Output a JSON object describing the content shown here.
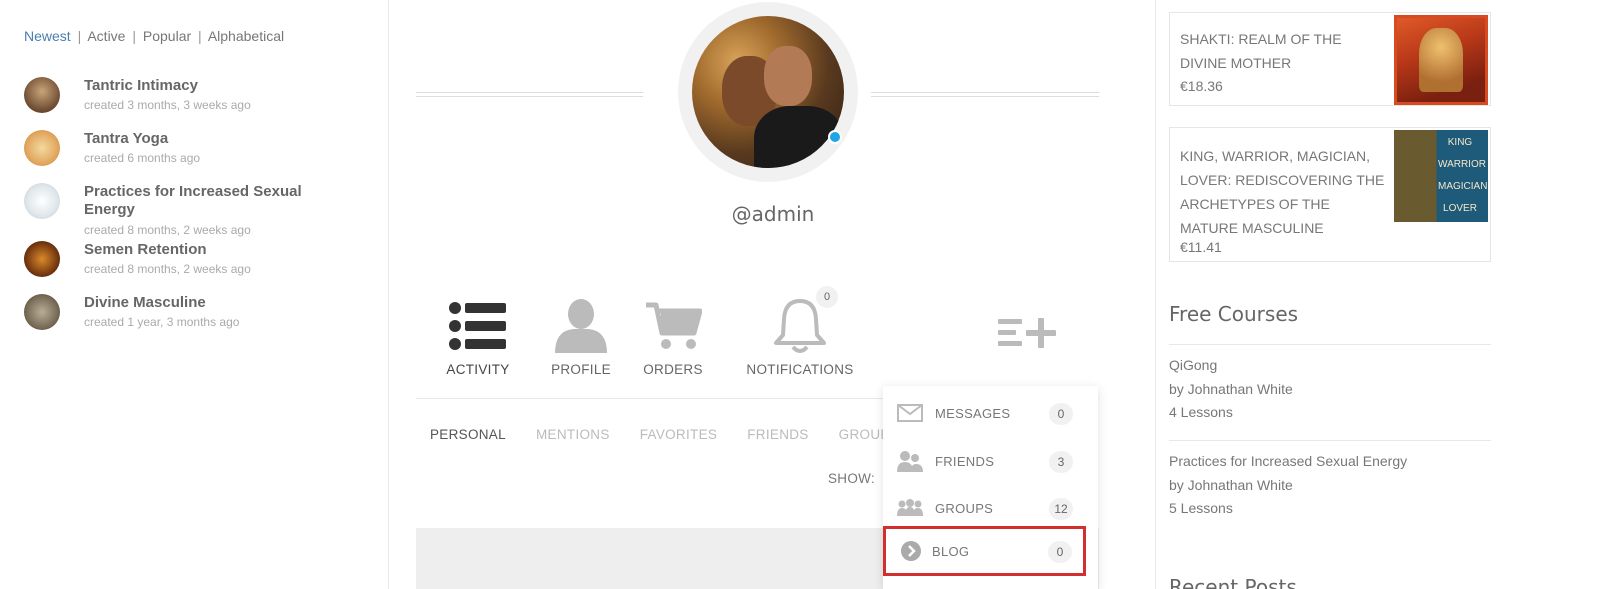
{
  "groups_filter": {
    "newest": "Newest",
    "active": "Active",
    "popular": "Popular",
    "alphabetical": "Alphabetical",
    "separator": "|"
  },
  "groups": [
    {
      "name": "Tantric Intimacy",
      "meta": "created 3 months, 3 weeks ago"
    },
    {
      "name": "Tantra Yoga",
      "meta": "created 6 months ago"
    },
    {
      "name": "Practices for Increased Sexual Energy",
      "meta": "created 8 months, 2 weeks ago"
    },
    {
      "name": "Semen Retention",
      "meta": "created 8 months, 2 weeks ago"
    },
    {
      "name": "Divine Masculine",
      "meta": "created 1 year, 3 months ago"
    }
  ],
  "profile": {
    "username": "@admin",
    "online_color": "#20a4e8"
  },
  "main_nav": [
    {
      "label": "ACTIVITY",
      "icon": "activity-list-icon"
    },
    {
      "label": "PROFILE",
      "icon": "user-silhouette-icon"
    },
    {
      "label": "ORDERS",
      "icon": "shopping-cart-icon"
    },
    {
      "label": "NOTIFICATIONS",
      "icon": "bell-icon",
      "count": "0"
    }
  ],
  "sub_nav": [
    "PERSONAL",
    "MENTIONS",
    "FAVORITES",
    "FRIENDS",
    "GROUPS"
  ],
  "show_label": "SHOW:",
  "dropdown": [
    {
      "label": "MESSAGES",
      "count": "0",
      "icon": "envelope-icon"
    },
    {
      "label": "FRIENDS",
      "count": "3",
      "icon": "friends-icon"
    },
    {
      "label": "GROUPS",
      "count": "12",
      "icon": "groups-icon"
    },
    {
      "label": "BLOG",
      "count": "0",
      "icon": "arrow-circle-icon"
    }
  ],
  "highlight_color": "#d32f2f",
  "products": [
    {
      "title": "SHAKTI: REALM OF THE DIVINE MOTHER",
      "price": "€18.36"
    },
    {
      "title": "KING, WARRIOR, MAGICIAN, LOVER: REDISCOVERING THE ARCHETYPES OF THE MATURE MASCULINE",
      "price": "€11.41",
      "cover_text": [
        "KING",
        "WARRIOR",
        "MAGICIAN",
        "LOVER"
      ]
    }
  ],
  "free_courses": {
    "title": "Free Courses",
    "items": [
      {
        "name": "QiGong",
        "author": "by Johnathan White",
        "lessons": "4 Lessons"
      },
      {
        "name": "Practices for Increased Sexual Energy",
        "author": "by Johnathan White",
        "lessons": "5 Lessons"
      }
    ]
  },
  "recent_posts_title": "Recent Posts"
}
